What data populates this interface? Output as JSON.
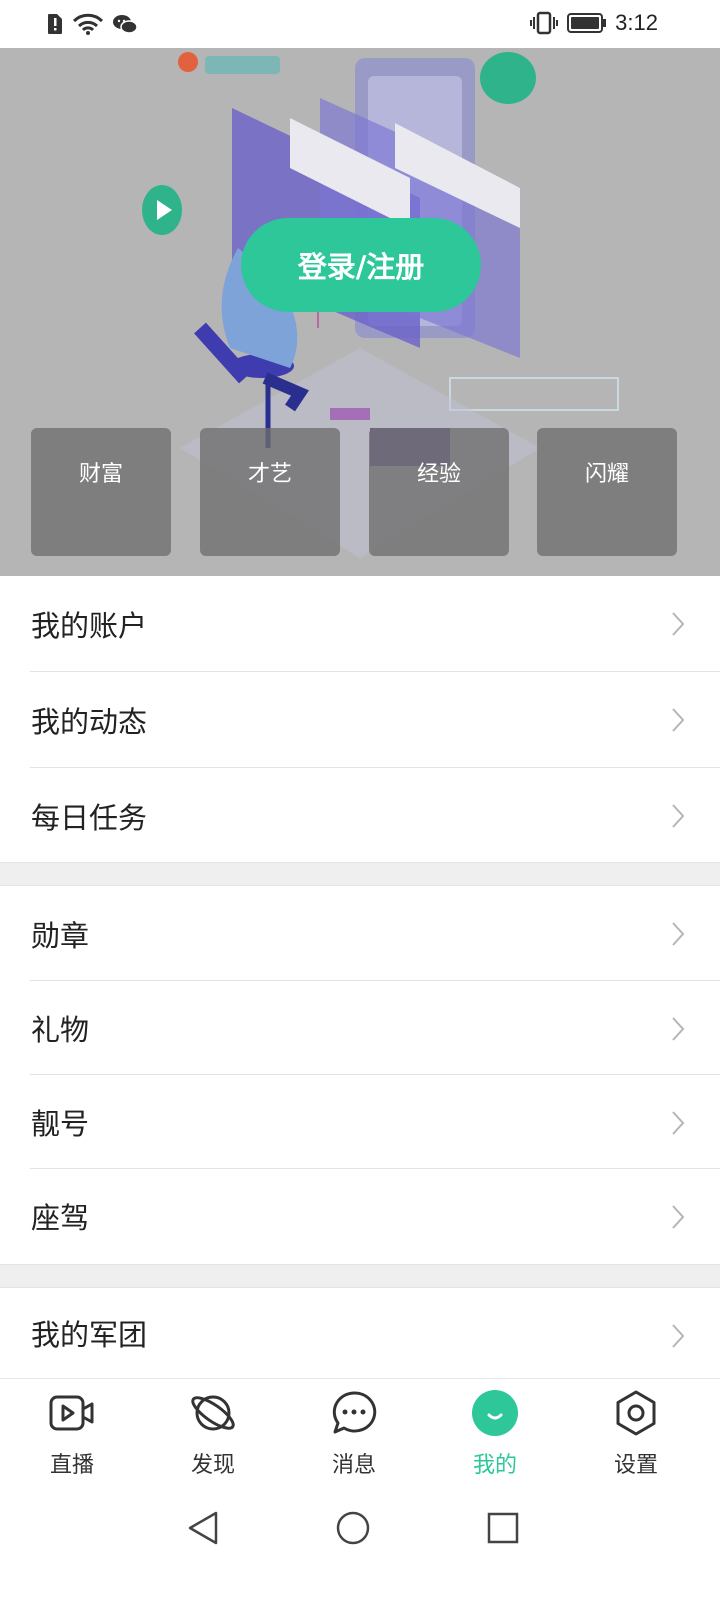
{
  "status_bar": {
    "time": "3:12"
  },
  "hero": {
    "login_label": "登录/注册",
    "stats": [
      "财富",
      "才艺",
      "经验",
      "闪耀"
    ]
  },
  "menu_group_1": [
    "我的账户",
    "我的动态",
    "每日任务"
  ],
  "menu_group_2": [
    "勋章",
    "礼物",
    "靓号",
    "座驾"
  ],
  "menu_group_3": [
    "我的军团"
  ],
  "tabs": [
    {
      "label": "直播",
      "icon": "live-video-icon"
    },
    {
      "label": "发现",
      "icon": "planet-icon"
    },
    {
      "label": "消息",
      "icon": "chat-bubble-icon"
    },
    {
      "label": "我的",
      "icon": "smile-face-icon",
      "active": true
    },
    {
      "label": "设置",
      "icon": "hexagon-settings-icon"
    }
  ],
  "colors": {
    "accent": "#2ec79a",
    "hero_overlay": "#b5b5b5"
  }
}
